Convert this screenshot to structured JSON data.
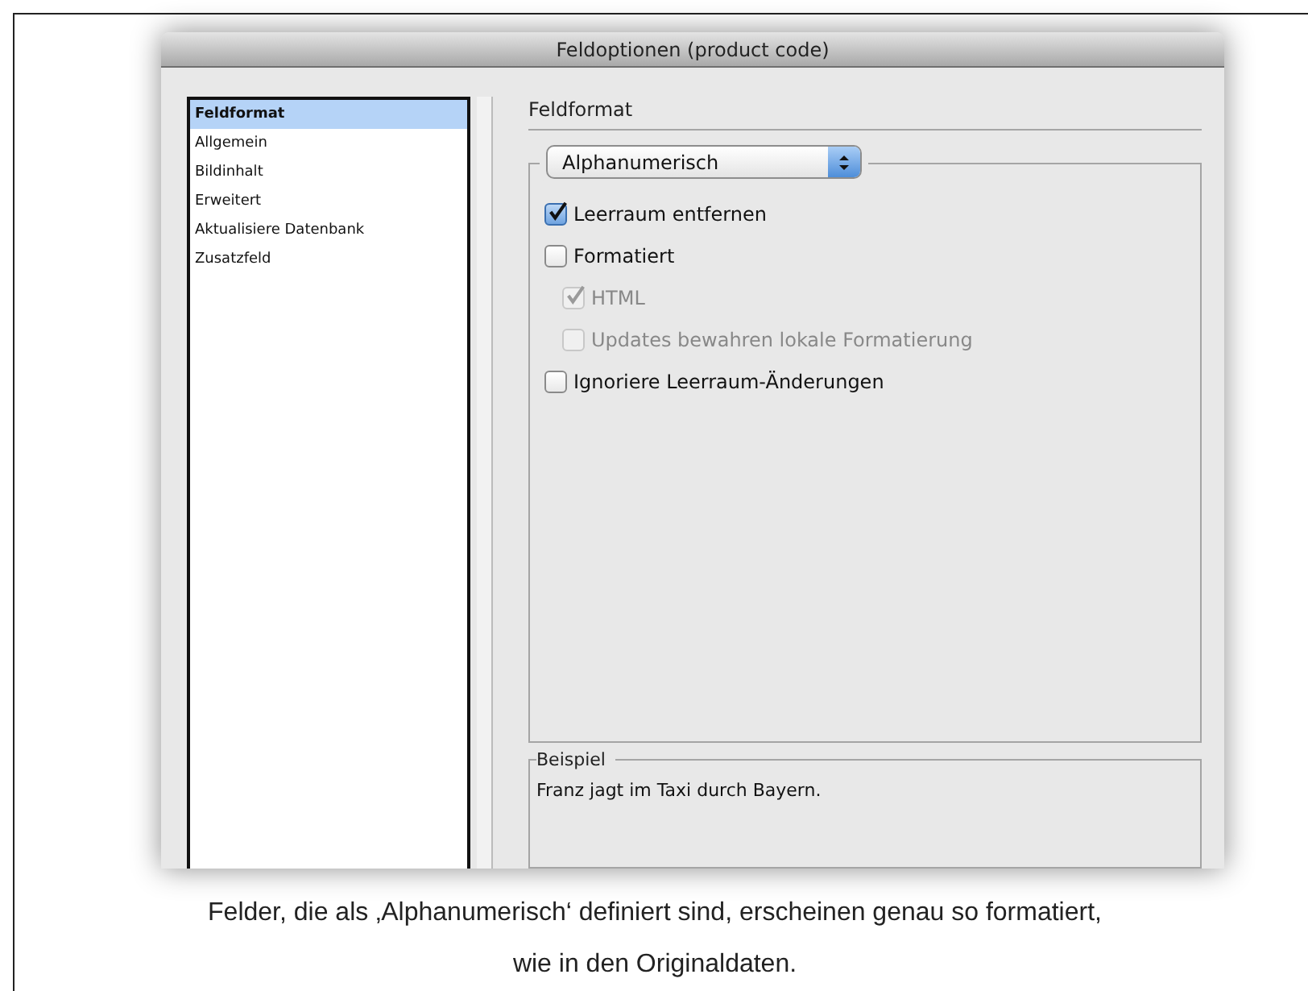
{
  "window": {
    "title": "Feldoptionen (product code)"
  },
  "sidebar": {
    "items": [
      {
        "label": "Feldformat",
        "selected": true
      },
      {
        "label": "Allgemein",
        "selected": false
      },
      {
        "label": "Bildinhalt",
        "selected": false
      },
      {
        "label": "Erweitert",
        "selected": false
      },
      {
        "label": "Aktualisiere Datenbank",
        "selected": false
      },
      {
        "label": "Zusatzfeld",
        "selected": false
      }
    ]
  },
  "section_title": "Feldformat",
  "format_select": {
    "value": "Alphanumerisch"
  },
  "options": [
    {
      "label": "Leerraum entfernen",
      "checked": true,
      "disabled": false
    },
    {
      "label": "Formatiert",
      "checked": false,
      "disabled": false,
      "children": [
        {
          "label": "HTML",
          "checked": true,
          "disabled": true
        },
        {
          "label": "Updates bewahren lokale Formatierung",
          "checked": false,
          "disabled": true
        }
      ]
    },
    {
      "label": "Ignoriere Leerraum-Änderungen",
      "checked": false,
      "disabled": false
    }
  ],
  "example": {
    "title": "Beispiel",
    "text": "Franz jagt im Taxi durch Bayern."
  },
  "caption": [
    "Felder, die als ‚Alphanumerisch‘ definiert sind, erscheinen genau so formatiert,",
    "wie in den Originaldaten."
  ]
}
